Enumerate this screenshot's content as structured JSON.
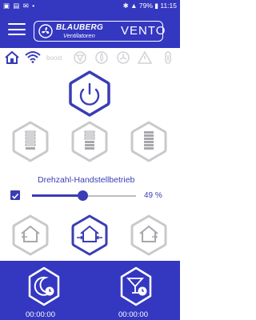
{
  "status_bar": {
    "battery_percent": "79%",
    "time": "11:15"
  },
  "header": {
    "brand": "BLAUBERG",
    "brand_sub": "Ventilatoren",
    "model": "VENTO"
  },
  "info_bar": {
    "boost_label": "boost"
  },
  "speed": {
    "label": "Drehzahl-Handstellbetrieb",
    "value_percent": 49,
    "value_text": "49 %",
    "manual_enabled": true
  },
  "timers": {
    "night_time": "00:00:00",
    "party_time": "00:00:00"
  },
  "colors": {
    "brand_blue": "#3437c0",
    "accent": "#3a3db4",
    "inactive_gray": "#a7a7ad",
    "light_gray": "#d2d2d6"
  },
  "icons": {
    "menu": "hamburger-icon",
    "home": "home-icon",
    "wifi": "wifi-icon",
    "power": "power-icon",
    "night": "moon-clock-icon",
    "party": "cocktail-clock-icon"
  }
}
